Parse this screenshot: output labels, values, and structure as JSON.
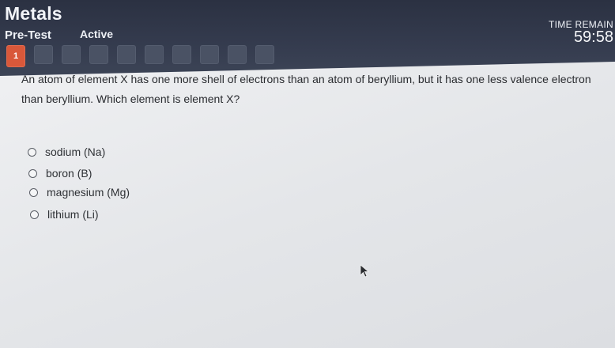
{
  "header": {
    "title": "Metals",
    "tabs": [
      {
        "label": "Pre-Test"
      },
      {
        "label": "Active"
      }
    ],
    "timer": {
      "label": "TIME REMAIN",
      "value": "59:58"
    }
  },
  "question_nav": {
    "current": "1"
  },
  "question": {
    "text": "An atom of element X has one more shell of electrons than an atom of beryllium, but it has one less valence electron than beryllium. Which element is element X?",
    "options": [
      {
        "label": "sodium (Na)"
      },
      {
        "label": "boron (B)"
      },
      {
        "label": "magnesium (Mg)"
      },
      {
        "label": "lithium (Li)"
      }
    ]
  },
  "colors": {
    "header_bg": "#2b3142",
    "current_question": "#d9583a"
  }
}
